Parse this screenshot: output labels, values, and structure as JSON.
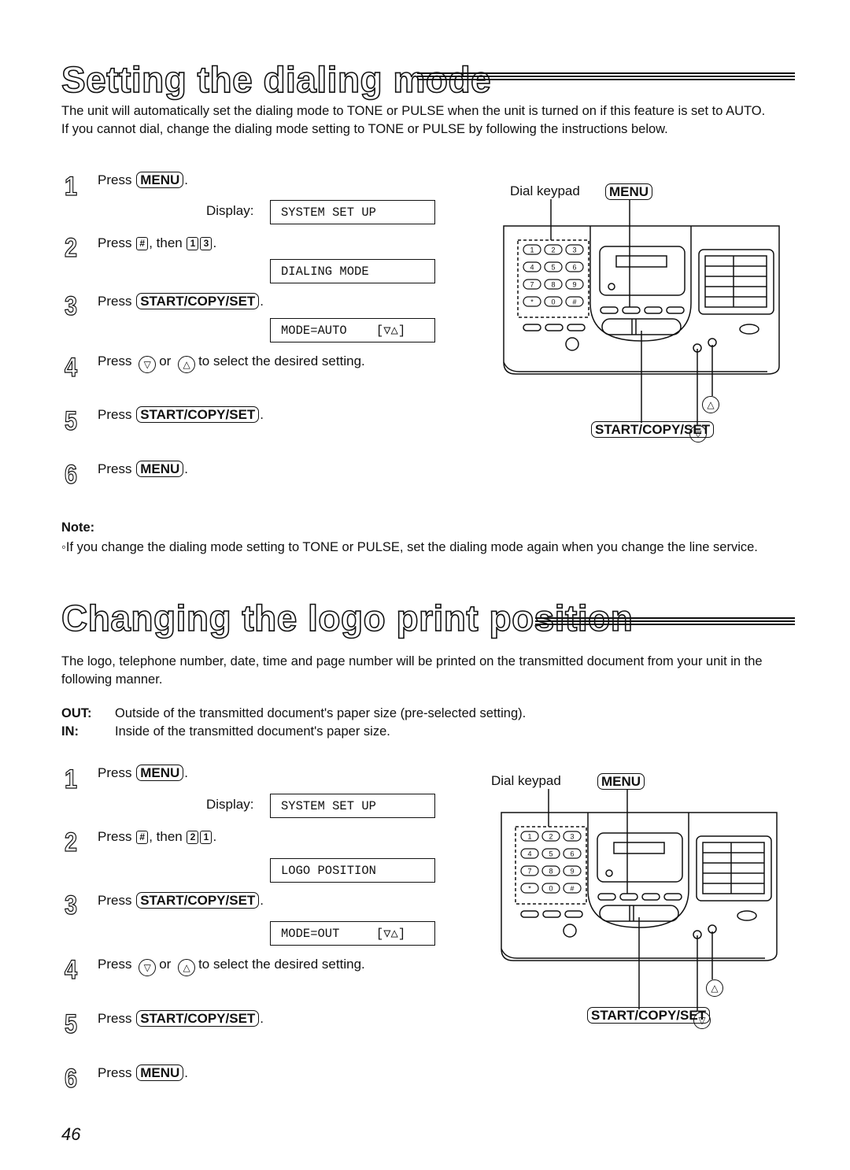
{
  "sections": [
    {
      "title": "Setting the dialing mode",
      "intro": [
        "The unit will automatically set the dialing mode to TONE or PULSE when the unit is turned on if this feature is set to AUTO.",
        "If you cannot dial, change the dialing mode setting to TONE or PULSE by following the instructions below."
      ],
      "steps": [
        {
          "num": "1",
          "prefix": "Press",
          "key": "MENU",
          "suffix": ".",
          "display_label": "Display:",
          "display": "SYSTEM SET UP"
        },
        {
          "num": "2",
          "prefix": "Press",
          "key1": "#",
          "mid": ", then",
          "key2": "1",
          "key3": "3",
          "suffix": ".",
          "display": "DIALING MODE"
        },
        {
          "num": "3",
          "prefix": "Press",
          "key": "START/COPY/SET",
          "suffix": ".",
          "display": "MODE=AUTO    [▽△]"
        },
        {
          "num": "4",
          "prefix": "Press",
          "down": "▽",
          "or": "or",
          "up": "△",
          "suffix": "to select the desired setting."
        },
        {
          "num": "5",
          "prefix": "Press",
          "key": "START/COPY/SET",
          "suffix": "."
        },
        {
          "num": "6",
          "prefix": "Press",
          "key": "MENU",
          "suffix": "."
        }
      ],
      "diagram": {
        "dial_keypad_label": "Dial keypad",
        "menu_label": "MENU",
        "start_label": "START/COPY/SET",
        "up_label": "△",
        "down_label": "▽",
        "keys": [
          "1",
          "2",
          "3",
          "4",
          "5",
          "6",
          "7",
          "8",
          "9",
          "*",
          "0",
          "#"
        ]
      },
      "note_title": "Note:",
      "note": "If you change the dialing mode setting to TONE or PULSE, set the dialing mode again when you change the line service."
    },
    {
      "title": "Changing the logo print position",
      "intro": [
        "The logo, telephone number, date, time and page number will be printed on the transmitted document from your unit in the following manner."
      ],
      "definitions": [
        {
          "term": "OUT:",
          "desc": "Outside of the transmitted document's paper size (pre-selected setting)."
        },
        {
          "term": "IN:",
          "desc": "Inside of the transmitted document's paper size."
        }
      ],
      "steps": [
        {
          "num": "1",
          "prefix": "Press",
          "key": "MENU",
          "suffix": ".",
          "display_label": "Display:",
          "display": "SYSTEM SET UP"
        },
        {
          "num": "2",
          "prefix": "Press",
          "key1": "#",
          "mid": ", then",
          "key2": "2",
          "key3": "1",
          "suffix": ".",
          "display": "LOGO POSITION"
        },
        {
          "num": "3",
          "prefix": "Press",
          "key": "START/COPY/SET",
          "suffix": ".",
          "display": "MODE=OUT     [▽△]"
        },
        {
          "num": "4",
          "prefix": "Press",
          "down": "▽",
          "or": "or",
          "up": "△",
          "suffix": "to select the desired setting."
        },
        {
          "num": "5",
          "prefix": "Press",
          "key": "START/COPY/SET",
          "suffix": "."
        },
        {
          "num": "6",
          "prefix": "Press",
          "key": "MENU",
          "suffix": "."
        }
      ],
      "diagram": {
        "dial_keypad_label": "Dial keypad",
        "menu_label": "MENU",
        "start_label": "START/COPY/SET",
        "up_label": "△",
        "down_label": "▽",
        "keys": [
          "1",
          "2",
          "3",
          "4",
          "5",
          "6",
          "7",
          "8",
          "9",
          "*",
          "0",
          "#"
        ]
      }
    }
  ],
  "page_number": "46"
}
